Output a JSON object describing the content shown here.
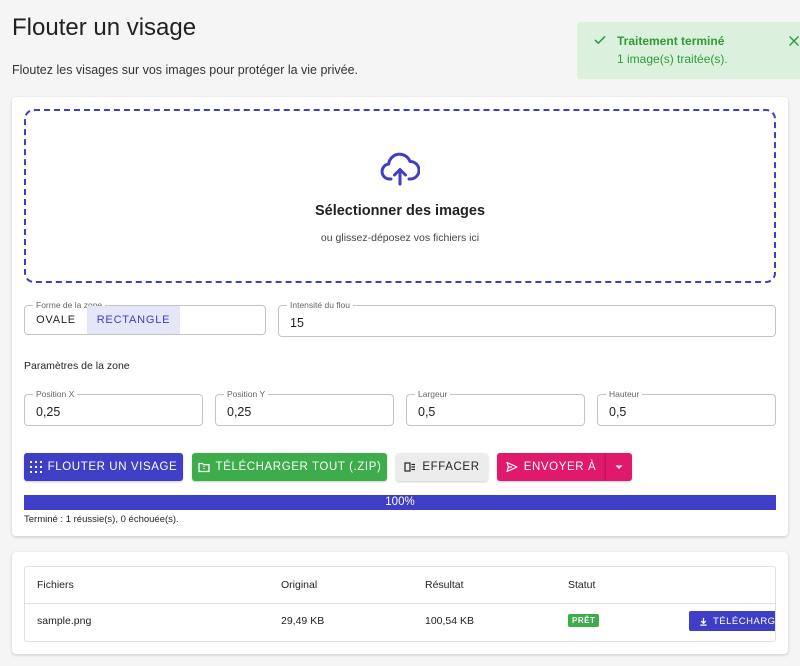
{
  "header": {
    "title": "Flouter un visage",
    "subtitle": "Floutez les visages sur vos images pour protéger la vie privée."
  },
  "toast": {
    "title": "Traitement terminé",
    "message": "1 image(s) traitée(s)."
  },
  "dropzone": {
    "title": "Sélectionner des images",
    "subtitle": "ou glissez-déposez vos fichiers ici"
  },
  "zone_shape": {
    "legend": "Forme de la zone",
    "options": [
      "OVALE",
      "RECTANGLE"
    ],
    "selected": "RECTANGLE"
  },
  "intensity": {
    "legend": "Intensité du flou",
    "value": "15"
  },
  "zone_params": {
    "label": "Paramètres de la zone",
    "position_x": {
      "legend": "Position X",
      "value": "0,25"
    },
    "position_y": {
      "legend": "Position Y",
      "value": "0,25"
    },
    "width": {
      "legend": "Largeur",
      "value": "0,5"
    },
    "height": {
      "legend": "Hauteur",
      "value": "0,5"
    }
  },
  "actions": {
    "blur": "FLOUTER UN VISAGE",
    "download_zip": "TÉLÉCHARGER TOUT (.ZIP)",
    "clear": "EFFACER",
    "send": "ENVOYER À"
  },
  "progress": {
    "value": 100,
    "label": "100%"
  },
  "status": "Terminé : 1 réussie(s), 0 échouée(s).",
  "files_table": {
    "columns": [
      "Fichiers",
      "Original",
      "Résultat",
      "Statut"
    ],
    "rows": [
      {
        "name": "sample.png",
        "original": "29,49 KB",
        "result": "100,54 KB",
        "status": "PRÊT",
        "action": "TÉLÉCHARGER"
      }
    ]
  },
  "colors": {
    "primary": "#3f3ec7",
    "success": "#3cad4a",
    "accent": "#e0196a",
    "toast_bg": "#dcf1dd"
  }
}
